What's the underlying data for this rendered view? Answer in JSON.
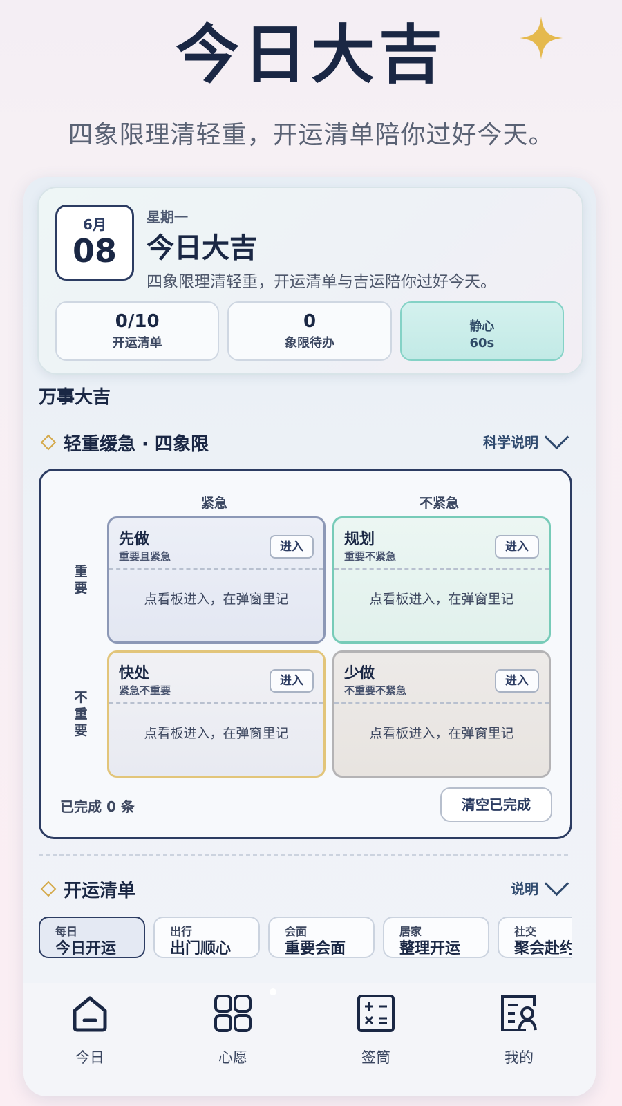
{
  "hero": {
    "title": "今日大吉",
    "subtitle": "四象限理清轻重，开运清单陪你过好今天。"
  },
  "date_card": {
    "month": "6月",
    "day": "08",
    "weekday": "星期一",
    "title": "今日大吉",
    "description": "四象限理清轻重，开运清单与吉运陪你过好今天。",
    "stats": [
      {
        "value": "0/10",
        "label": "开运清单"
      },
      {
        "value": "0",
        "label": "象限待办"
      },
      {
        "value": "静心",
        "label": "60s"
      }
    ]
  },
  "section_label": "万事大吉",
  "quadrant_section": {
    "title": "轻重缓急 · 四象限",
    "link": "科学说明",
    "col_labels": [
      "紧急",
      "不紧急"
    ],
    "row_labels": [
      "重要",
      "不重要"
    ],
    "quadrants": [
      {
        "name": "先做",
        "sub": "重要且紧急",
        "button": "进入",
        "hint": "点看板进入，在弹窗里记"
      },
      {
        "name": "规划",
        "sub": "重要不紧急",
        "button": "进入",
        "hint": "点看板进入，在弹窗里记"
      },
      {
        "name": "快处",
        "sub": "紧急不重要",
        "button": "进入",
        "hint": "点看板进入，在弹窗里记"
      },
      {
        "name": "少做",
        "sub": "不重要不紧急",
        "button": "进入",
        "hint": "点看板进入，在弹窗里记"
      }
    ],
    "completed_text": "已完成 0 条",
    "clear_button": "清空已完成"
  },
  "list_section": {
    "title": "开运清单",
    "link": "说明",
    "chips": [
      {
        "category": "每日",
        "name": "今日开运",
        "active": true
      },
      {
        "category": "出行",
        "name": "出门顺心"
      },
      {
        "category": "会面",
        "name": "重要会面"
      },
      {
        "category": "居家",
        "name": "整理开运"
      },
      {
        "category": "社交",
        "name": "聚会赴约"
      }
    ]
  },
  "tabbar": [
    {
      "label": "今日",
      "icon": "home-icon"
    },
    {
      "label": "心愿",
      "icon": "grid-icon"
    },
    {
      "label": "签筒",
      "icon": "calculator-icon"
    },
    {
      "label": "我的",
      "icon": "profile-card-icon"
    }
  ],
  "colors": {
    "navy": "#1a2744",
    "teal": "#77cbb8",
    "gold": "#e2c57a",
    "sparkle": "#e5b94e"
  }
}
